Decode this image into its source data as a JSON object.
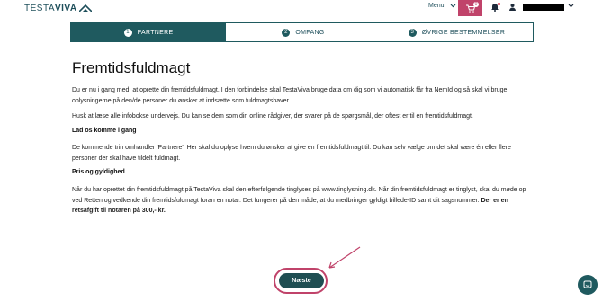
{
  "header": {
    "logo_left": "TESTA",
    "logo_right": "VIVA",
    "menu_label": "Menu",
    "cart_count": "0"
  },
  "steps": [
    {
      "num": "1",
      "label": "PARTNERE"
    },
    {
      "num": "2",
      "label": "OMFANG"
    },
    {
      "num": "3",
      "label": "ØVRIGE BESTEMMELSER"
    }
  ],
  "main": {
    "title": "Fremtidsfuldmagt",
    "intro": "Du er nu i gang med, at oprette din fremtidsfuldmagt. I den forbindelse skal TestaViva bruge data om dig som vi automatisk får fra NemId og så skal vi bruge oplysningerne på den/de personer du ønsker at indsætte som fuldmagtshaver.",
    "help": "Husk at læse alle infobokse undervejs. Du kan se dem som din online rådgiver, der svarer på de spørgsmål, der oftest er til en fremtidsfuldmagt.",
    "h1": "Lad os komme i gang",
    "p1": "De kommende trin omhandler 'Partnere'. Her skal du oplyse hvem du ønsker at give en fremtidsfuldmagt til. Du kan selv vælge om det skal være én eller flere personer der skal have tildelt fuldmagt.",
    "h2": "Pris og gyldighed",
    "p2": "Når du har oprettet din fremtidsfuldmagt på TestaViva skal den efterfølgende tinglyses på www.tinglysning.dk. Når din fremtidsfuldmagt er tinglyst, skal du møde op ved Retten og vedkende din fremtidsfuldmagt foran en notar. Det fungerer på den måde, at du medbringer gyldigt billede-ID samt dit sagsnummer.",
    "p2_bold": "Der er en retsafgift til notaren på 300,- kr."
  },
  "next_label": "Næste",
  "colors": {
    "primary": "#1f5a5f",
    "accent": "#c0436a"
  }
}
